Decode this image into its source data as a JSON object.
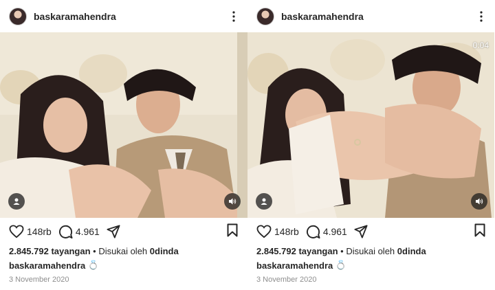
{
  "posts": [
    {
      "username": "baskaramahendra",
      "likes": "148rb",
      "comments": "4.961",
      "views": "2.845.792 tayangan",
      "liked_by_prefix": "Disukai oleh",
      "liked_by_user": "0dinda",
      "caption_user": "baskaramahendra",
      "caption_emoji": "💍",
      "date": "3 November 2020",
      "timer": ""
    },
    {
      "username": "baskaramahendra",
      "likes": "148rb",
      "comments": "4.961",
      "views": "2.845.792 tayangan",
      "liked_by_prefix": "Disukai oleh",
      "liked_by_user": "0dinda",
      "caption_user": "baskaramahendra",
      "caption_emoji": "💍",
      "date": "3 November 2020",
      "timer": "0:04"
    }
  ],
  "separator": "•",
  "icons": {
    "more": "more-vertical-icon",
    "like": "heart-icon",
    "comment": "comment-icon",
    "share": "send-icon",
    "save": "bookmark-icon",
    "tagged": "user-tag-icon",
    "sound": "speaker-icon"
  }
}
